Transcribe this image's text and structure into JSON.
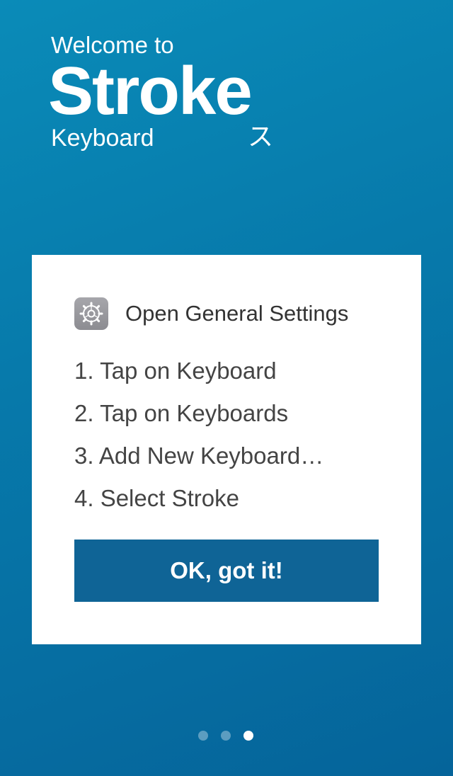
{
  "header": {
    "welcome": "Welcome to",
    "brand": "Stroke",
    "subtitle": "Keyboard",
    "kana": "ス"
  },
  "card": {
    "settings_title": "Open General Settings",
    "settings_icon": "gear-icon",
    "steps": [
      "1. Tap on Keyboard",
      "2. Tap on Keyboards",
      "3. Add New Keyboard…",
      "4. Select Stroke"
    ],
    "ok_label": "OK, got it!"
  },
  "pager": {
    "total_pages": 3,
    "current_page": 3
  },
  "colors": {
    "background_top": "#0a8bb8",
    "background_bottom": "#05649a",
    "button": "#0f6496",
    "card": "#ffffff",
    "settings_icon": "#8e8e93"
  }
}
